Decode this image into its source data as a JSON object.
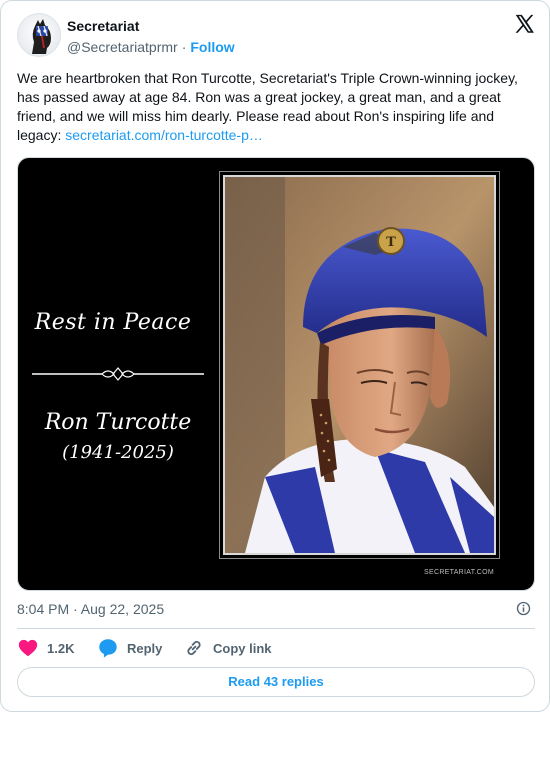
{
  "author": {
    "display_name": "Secretariat",
    "handle": "@Secretariatprmr",
    "separator": "·",
    "follow_label": "Follow"
  },
  "tweet": {
    "text": "We are heartbroken that Ron Turcotte, Secretariat's Triple Crown-winning jockey, has passed away at age 84. Ron was a great jockey, a great man, and a great friend, and we will miss him dearly. Please read about Ron's inspiring life and legacy: ",
    "link_text": "secretariat.com/ron-turcotte-p…"
  },
  "media": {
    "rest_in_peace": "Rest in Peace",
    "name": "Ron Turcotte",
    "years": "(1941-2025)",
    "watermark": "SECRETARIAT.COM",
    "helmet_initial": "T"
  },
  "timestamp": "8:04 PM · Aug 22, 2025",
  "actions": {
    "like_count": "1.2K",
    "reply_label": "Reply",
    "copy_label": "Copy link"
  },
  "read_replies_label": "Read 43 replies",
  "colors": {
    "accent": "#1d9bf0",
    "like": "#f91880",
    "text": "#0f1419",
    "muted": "#536471",
    "border": "#cfd9de"
  },
  "icons": {
    "brand": "x-logo-icon",
    "info": "info-icon",
    "like": "heart-icon",
    "reply": "speech-bubble-icon",
    "copy": "link-icon"
  }
}
